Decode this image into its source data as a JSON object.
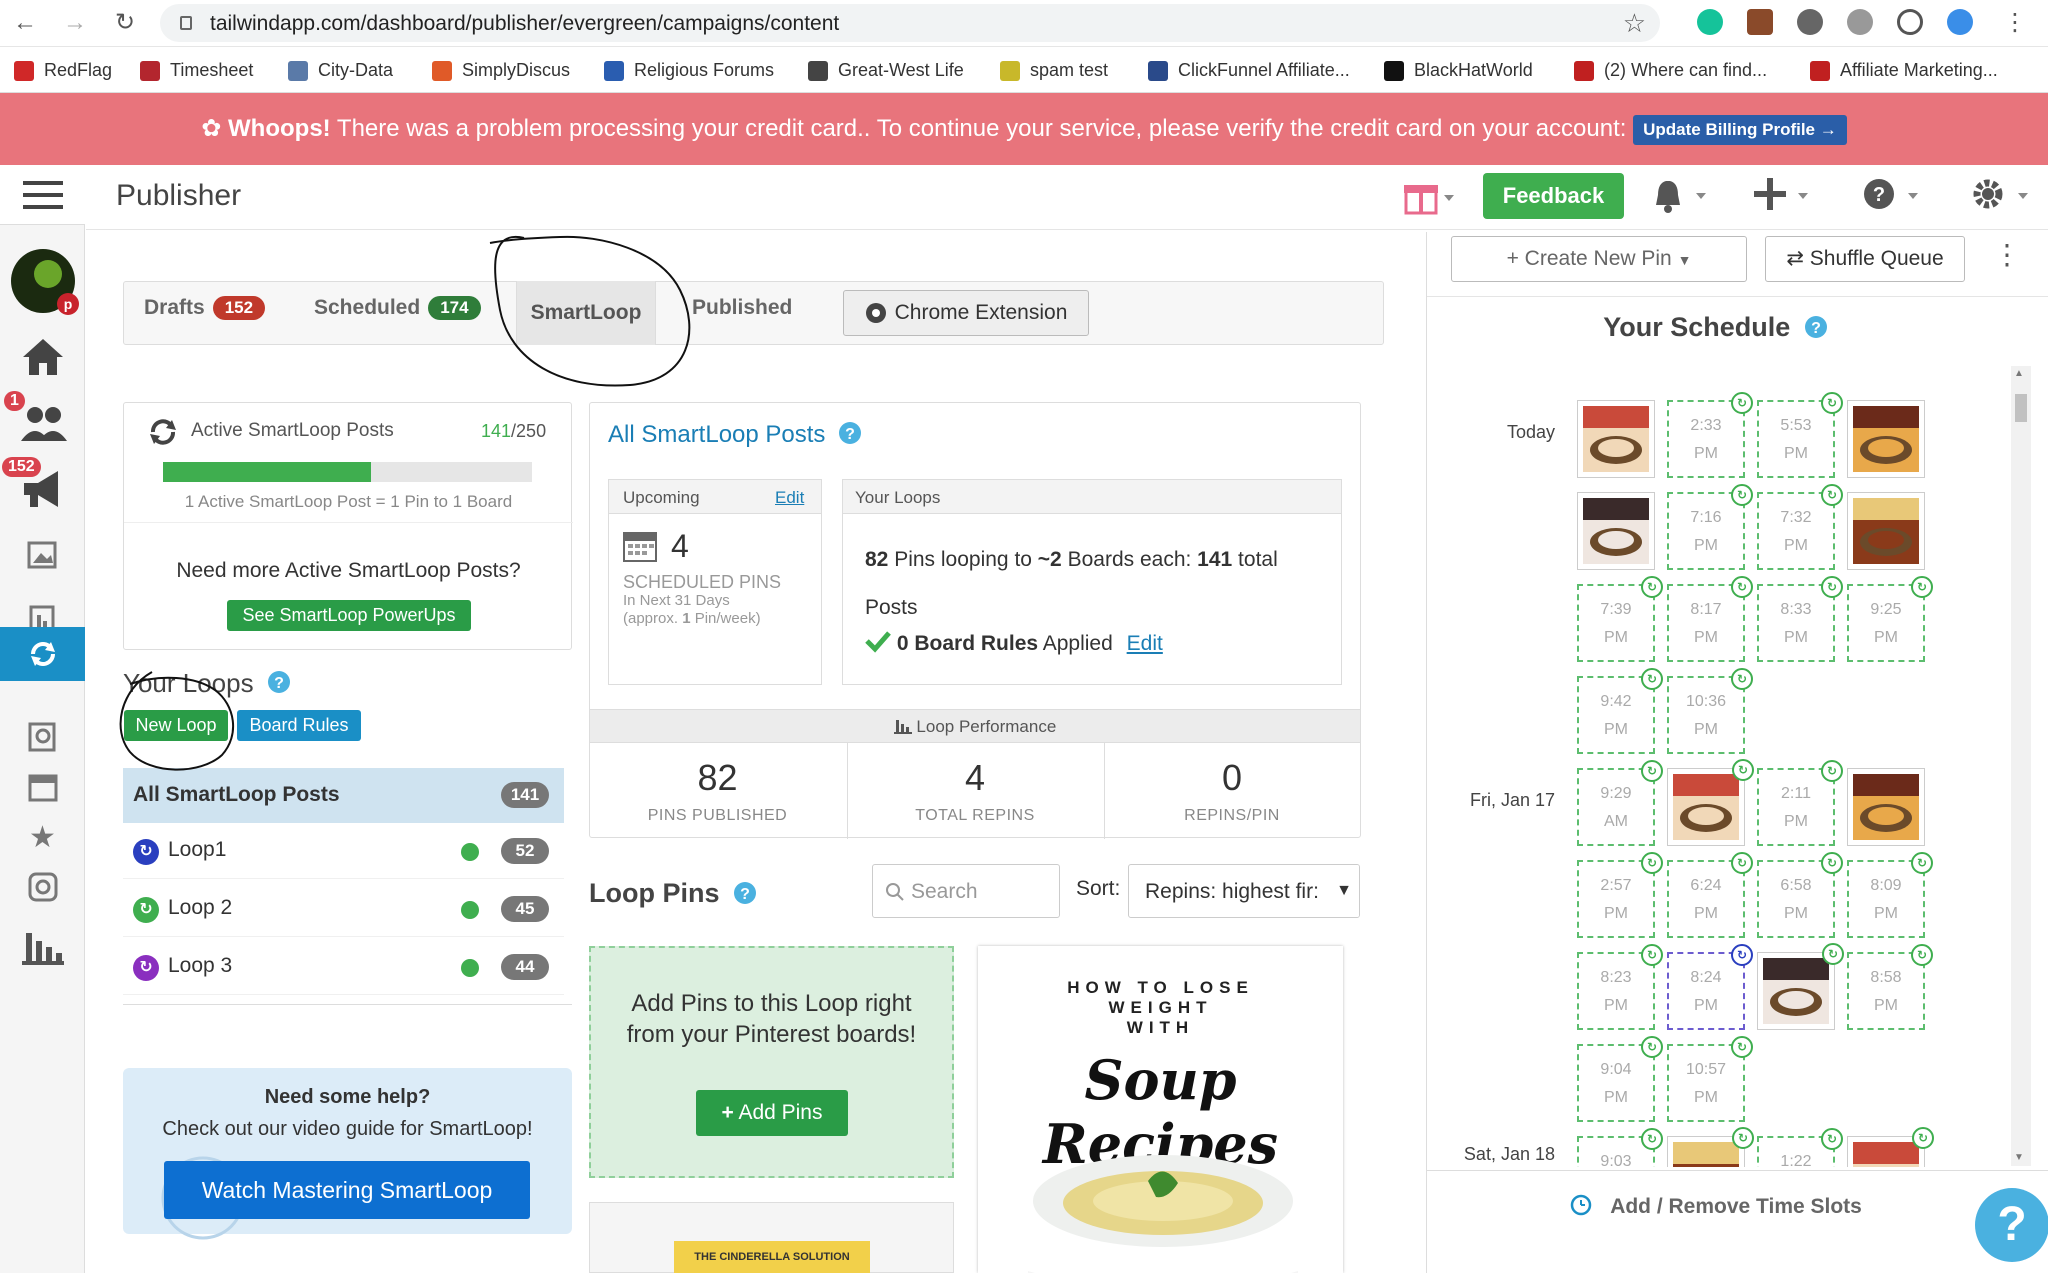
{
  "browser": {
    "url": "tailwindapp.com/dashboard/publisher/evergreen/campaigns/content"
  },
  "bookmarks": [
    {
      "label": "RedFlag",
      "color": "#d02828"
    },
    {
      "label": "Timesheet",
      "color": "#b3262e"
    },
    {
      "label": "City-Data",
      "color": "#5a7aa8"
    },
    {
      "label": "SimplyDiscus",
      "color": "#e05a28"
    },
    {
      "label": "Religious Forums",
      "color": "#2a5db0"
    },
    {
      "label": "Great-West Life",
      "color": "#444444"
    },
    {
      "label": "spam test",
      "color": "#c8b82a"
    },
    {
      "label": "ClickFunnel Affiliate...",
      "color": "#2a4a8a"
    },
    {
      "label": "BlackHatWorld",
      "color": "#111111"
    },
    {
      "label": "(2) Where can find...",
      "color": "#c02020"
    },
    {
      "label": "Affiliate Marketing...",
      "color": "#c02020"
    }
  ],
  "alert": {
    "strong": "Whoops!",
    "message": "There was a problem processing your credit card.. To continue your service, please verify the credit card on your account:",
    "button": "Update Billing Profile →"
  },
  "leftnav": {
    "badge_users": "1",
    "badge_megaphone": "152"
  },
  "header": {
    "title": "Publisher",
    "feedback": "Feedback"
  },
  "tabs": {
    "drafts": {
      "label": "Drafts",
      "count": "152"
    },
    "scheduled": {
      "label": "Scheduled",
      "count": "174"
    },
    "smartloop": {
      "label": "SmartLoop"
    },
    "published": {
      "label": "Published"
    },
    "chrome_extension": "Chrome Extension"
  },
  "active_posts": {
    "title": "Active SmartLoop Posts",
    "used": "141",
    "limit": "/250",
    "progress_fraction": 0.564,
    "note": "1 Active SmartLoop Post = 1 Pin to 1 Board",
    "need_more": "Need more Active SmartLoop Posts?",
    "powerups_button": "See SmartLoop PowerUps"
  },
  "your_loops": {
    "title": "Your Loops",
    "new_loop": "New Loop",
    "board_rules": "Board Rules",
    "all_label": "All SmartLoop Posts",
    "all_count": "141",
    "loops": [
      {
        "name": "Loop1",
        "count": "52",
        "color": "#2a3fbf"
      },
      {
        "name": "Loop 2",
        "count": "45",
        "color": "#3fae4f"
      },
      {
        "name": "Loop 3",
        "count": "44",
        "color": "#8a2fbf"
      }
    ]
  },
  "help": {
    "title": "Need some help?",
    "text": "Check out our video guide for SmartLoop!",
    "button": "Watch Mastering SmartLoop"
  },
  "all_posts": {
    "title": "All SmartLoop Posts",
    "upcoming_label": "Upcoming",
    "edit": "Edit",
    "scheduled_count": "4",
    "scheduled_label": "SCHEDULED PINS",
    "next_days": "In Next 31 Days",
    "approx_prefix": "(approx. ",
    "approx_num": "1",
    "approx_suffix": " Pin/week)",
    "your_loops_label": "Your Loops",
    "pins_looping": "82",
    "looping_text1": " Pins looping to ",
    "boards": "~2",
    "looping_text2": " Boards each: ",
    "total": "141",
    "looping_text3": " total",
    "posts_word": "Posts",
    "board_rules_count": "0 Board Rules",
    "applied": " Applied",
    "edit2": "Edit",
    "performance_label": "Loop Performance",
    "stats": [
      {
        "value": "82",
        "label": "PINS PUBLISHED"
      },
      {
        "value": "4",
        "label": "TOTAL REPINS"
      },
      {
        "value": "0",
        "label": "REPINS/PIN"
      }
    ]
  },
  "loop_pins": {
    "title": "Loop Pins",
    "search_placeholder": "Search",
    "sort_label": "Sort:",
    "sort_value": "Repins: highest fir:",
    "add_text": "Add Pins to this Loop right from your Pinterest boards!",
    "add_button": "Add Pins",
    "pin_line1": "HOW TO LOSE",
    "pin_line2": "WEIGHT",
    "pin_line3": "WITH",
    "pin_script": "Soup Recipes",
    "pin2_label": "THE CINDERELLA SOLUTION"
  },
  "schedule": {
    "create_pin": "Create New Pin",
    "shuffle": "Shuffle Queue",
    "title": "Your Schedule",
    "add_remove": "Add / Remove Time Slots",
    "days": [
      "Today",
      "Fri, Jan 17",
      "Sat, Jan 18"
    ],
    "slots": [
      [
        "pin",
        "2:33 PM",
        "5:53 PM",
        "pin"
      ],
      [
        "pin",
        "7:16 PM",
        "7:32 PM",
        "pin"
      ],
      [
        "7:39 PM",
        "8:17 PM",
        "8:33 PM",
        "9:25 PM"
      ],
      [
        "9:42 PM",
        "10:36 PM"
      ],
      [
        "9:29 AM",
        "pin",
        "2:11 PM",
        "pin"
      ],
      [
        "2:57 PM",
        "6:24 PM",
        "6:58 PM",
        "8:09 PM"
      ],
      [
        "8:23 PM",
        "8:24 PM",
        "pin",
        "8:58 PM"
      ],
      [
        "9:04 PM",
        "10:57 PM"
      ],
      [
        "9:03",
        "pin",
        "1:22",
        "pin"
      ]
    ]
  }
}
